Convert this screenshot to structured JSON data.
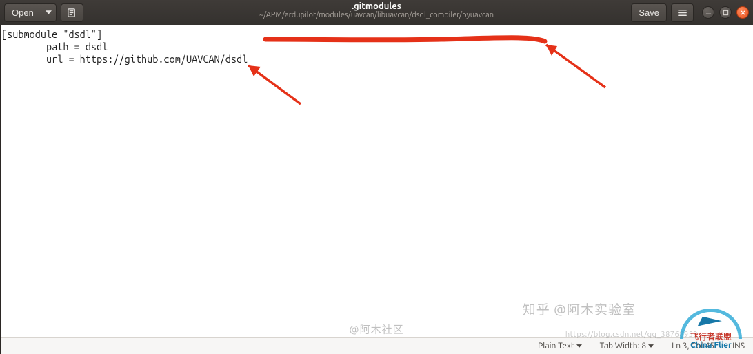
{
  "header": {
    "open_label": "Open",
    "new_tab_icon": "new-tab-icon",
    "title": ".gitmodules",
    "subtitle": "~/APM/ardupilot/modules/uavcan/libuavcan/dsdl_compiler/pyuavcan",
    "save_label": "Save",
    "menu_icon": "hamburger-icon"
  },
  "editor": {
    "lines": [
      "[submodule \"dsdl\"]",
      "        path = dsdl",
      "        url = https://github.com/UAVCAN/dsdl"
    ],
    "caret_line": 3,
    "caret_col": 45
  },
  "statusbar": {
    "syntax_label": "Plain Text",
    "tabwidth_label": "Tab Width: 8",
    "position_label": "Ln 3, Col 45",
    "insert_label": "INS"
  },
  "watermarks": {
    "center": "@阿木社区",
    "right1": "知乎 @阿木实验室",
    "right2": "https://blog.csdn.net/qq_38768959",
    "logo_cn": "飞行者联盟",
    "logo_en": "China Flier"
  },
  "annotation": {
    "color": "#e53118"
  }
}
